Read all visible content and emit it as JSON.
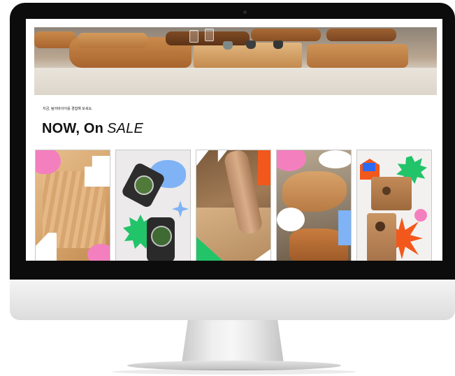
{
  "page": {
    "subtitle": "지금, 팀어바이어를 경험해 보세요.",
    "headline_main": "NOW, On",
    "headline_accent": "SALE"
  },
  "hero": {
    "image": "wooden-boards-and-cups-photo"
  },
  "products": [
    {
      "image": "wood-plank-collage"
    },
    {
      "image": "bottle-product-collage"
    },
    {
      "image": "woodworking-hands-collage"
    },
    {
      "image": "wood-slab-collage"
    },
    {
      "image": "wooden-box-speaker-collage"
    }
  ],
  "colors": {
    "accent_pink": "#f47fbf",
    "accent_blue": "#7fb3f5",
    "accent_green": "#22c46a",
    "accent_orange": "#f2581c",
    "bezel": "#0c0c0c"
  }
}
